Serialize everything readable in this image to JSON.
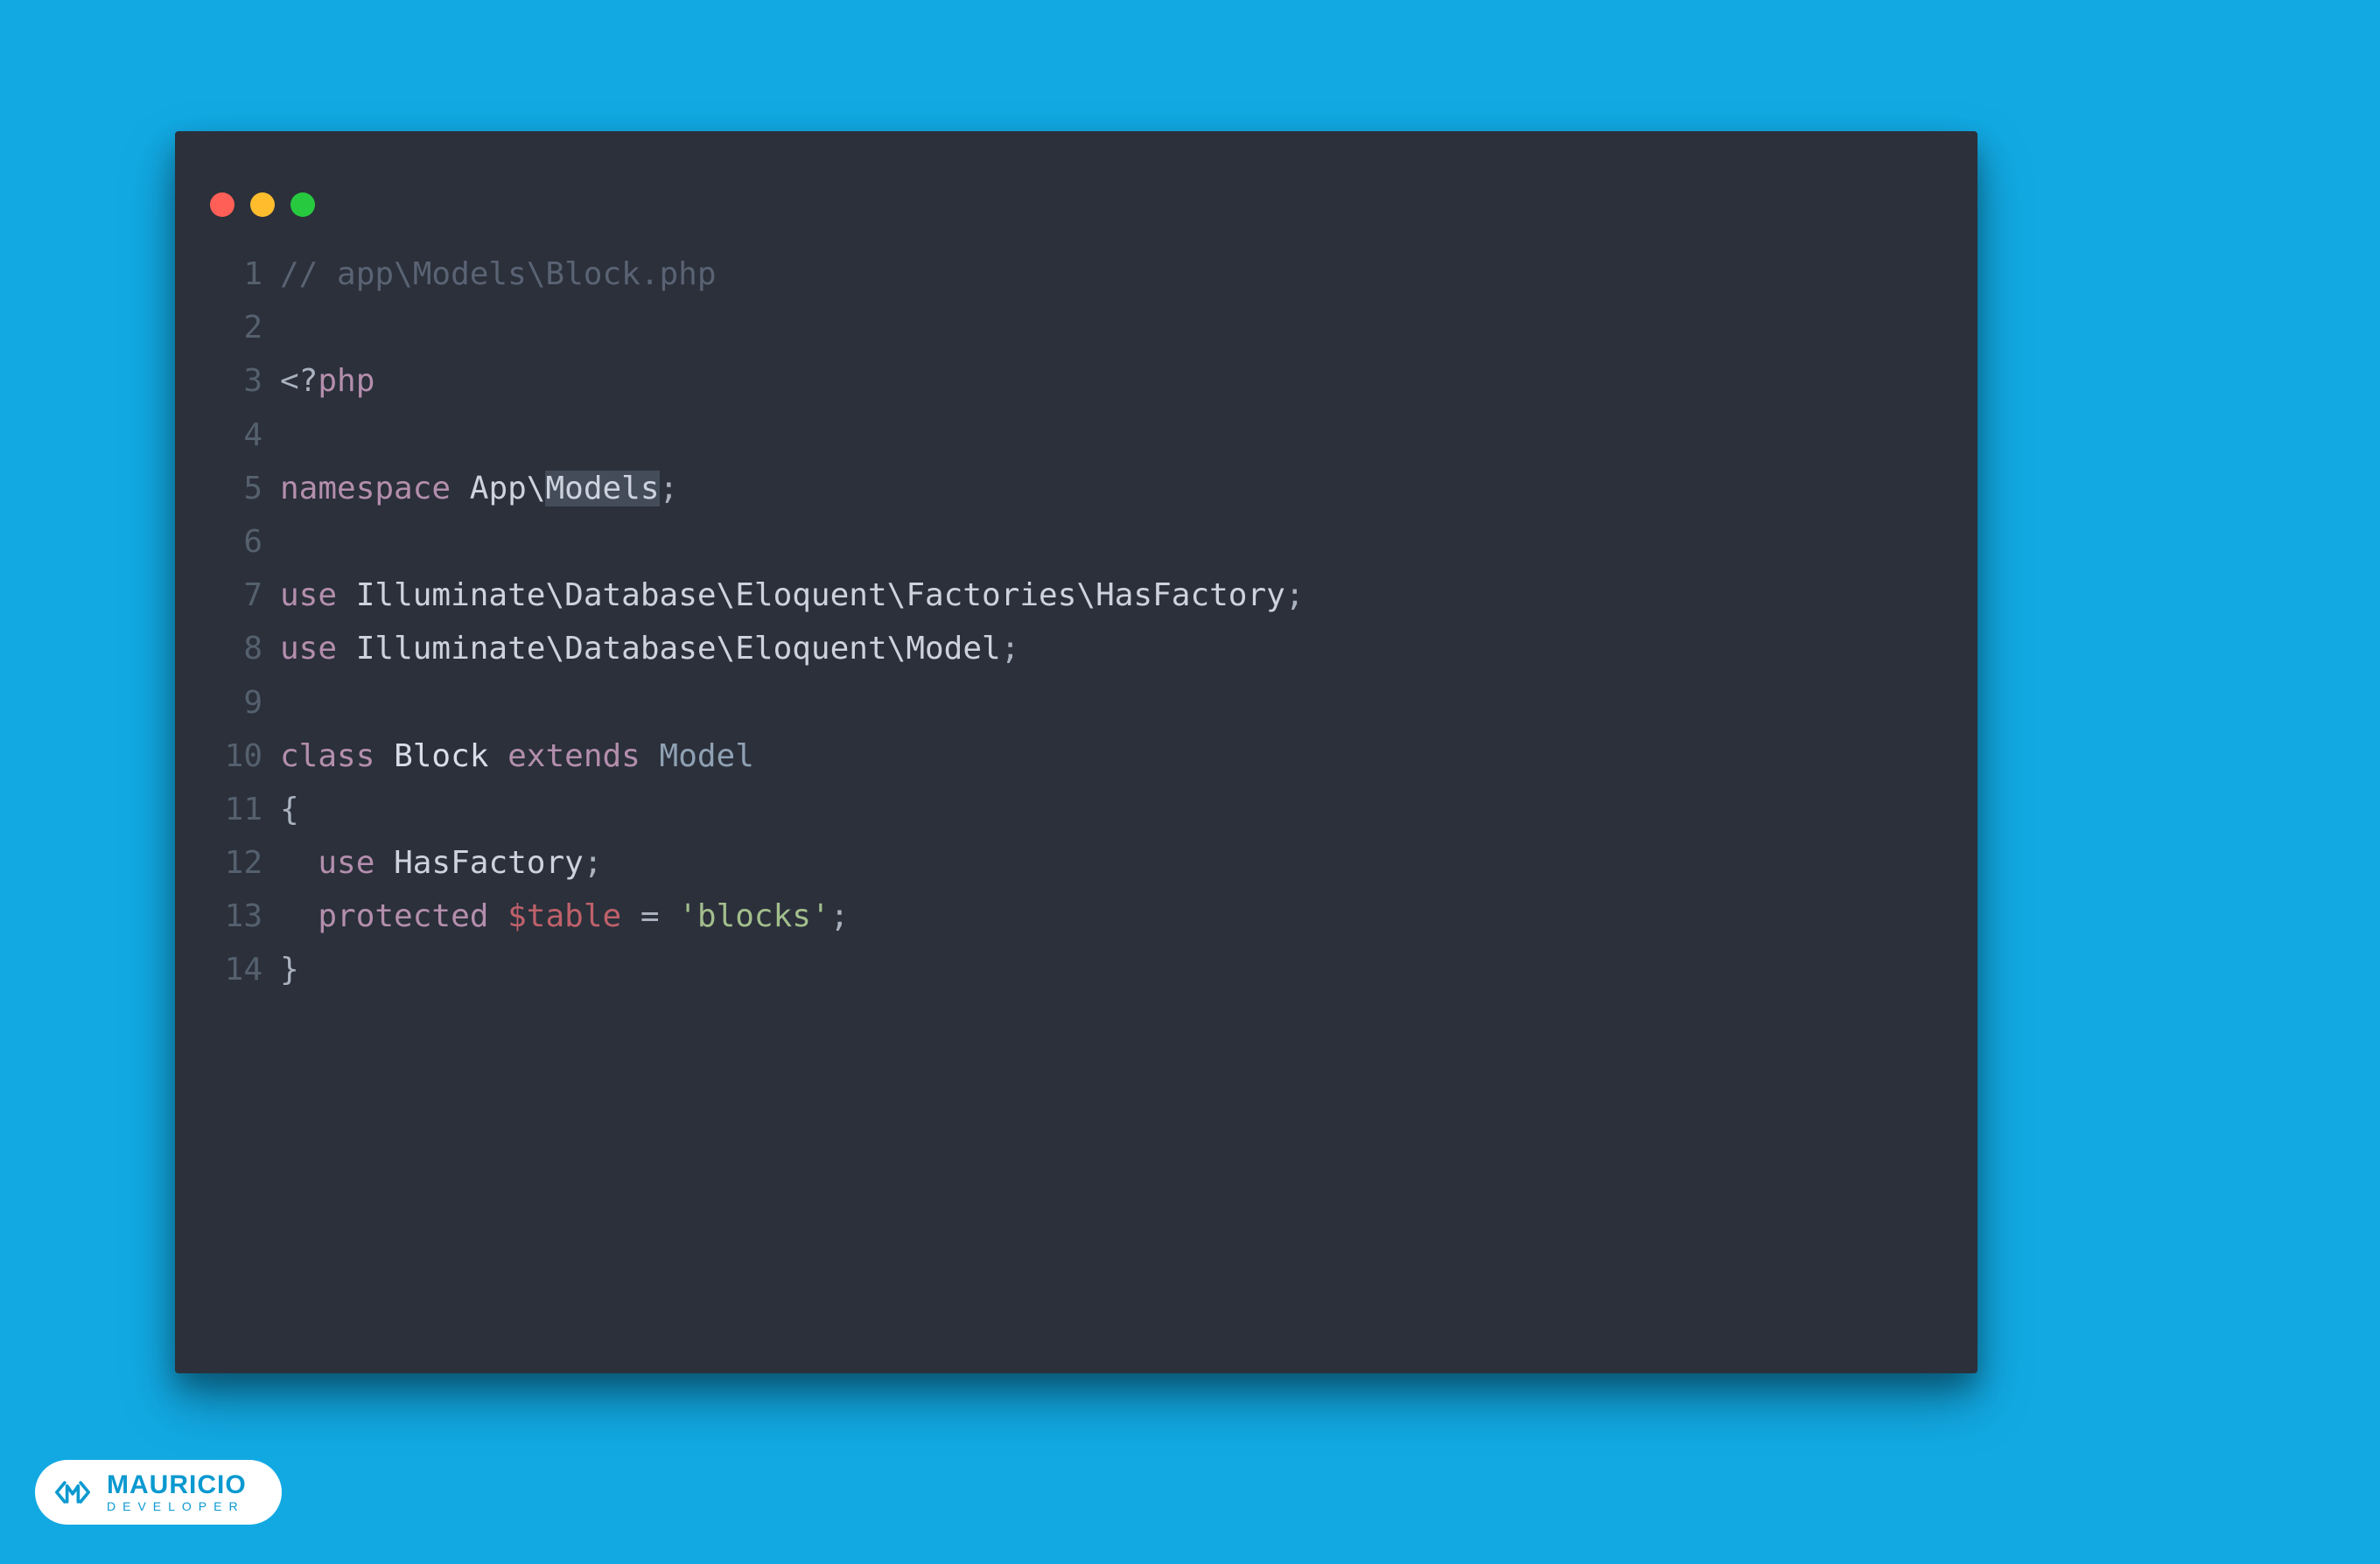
{
  "colors": {
    "background": "#12a9e3",
    "editor_bg": "#2b303b",
    "traffic_red": "#ff5f56",
    "traffic_yellow": "#ffbd2e",
    "traffic_green": "#27c93f"
  },
  "watermark": {
    "name": "MAURICIO",
    "subtitle": "DEVELOPER"
  },
  "code": {
    "language": "php",
    "file_path_comment": "// app\\Models\\Block.php",
    "lines": [
      {
        "n": "1",
        "tokens": [
          [
            "comment",
            "// app\\Models\\Block.php"
          ]
        ]
      },
      {
        "n": "2",
        "tokens": []
      },
      {
        "n": "3",
        "tokens": [
          [
            "punct",
            "<?"
          ],
          [
            "keyword",
            "php"
          ]
        ]
      },
      {
        "n": "4",
        "tokens": []
      },
      {
        "n": "5",
        "tokens": [
          [
            "keyword",
            "namespace"
          ],
          [
            "plain",
            " "
          ],
          [
            "plain",
            "App"
          ],
          [
            "plain",
            "\\"
          ],
          [
            "highlight",
            "Models"
          ],
          [
            "punct",
            ";"
          ]
        ]
      },
      {
        "n": "6",
        "tokens": []
      },
      {
        "n": "7",
        "tokens": [
          [
            "keyword",
            "use"
          ],
          [
            "plain",
            " "
          ],
          [
            "plain",
            "Illuminate"
          ],
          [
            "plain",
            "\\"
          ],
          [
            "plain",
            "Database"
          ],
          [
            "plain",
            "\\"
          ],
          [
            "plain",
            "Eloquent"
          ],
          [
            "plain",
            "\\"
          ],
          [
            "plain",
            "Factories"
          ],
          [
            "plain",
            "\\"
          ],
          [
            "plain",
            "HasFactory"
          ],
          [
            "punct",
            ";"
          ]
        ]
      },
      {
        "n": "8",
        "tokens": [
          [
            "keyword",
            "use"
          ],
          [
            "plain",
            " "
          ],
          [
            "plain",
            "Illuminate"
          ],
          [
            "plain",
            "\\"
          ],
          [
            "plain",
            "Database"
          ],
          [
            "plain",
            "\\"
          ],
          [
            "plain",
            "Eloquent"
          ],
          [
            "plain",
            "\\"
          ],
          [
            "plain",
            "Model"
          ],
          [
            "punct",
            ";"
          ]
        ]
      },
      {
        "n": "9",
        "tokens": []
      },
      {
        "n": "10",
        "tokens": [
          [
            "keyword",
            "class"
          ],
          [
            "plain",
            " "
          ],
          [
            "class",
            "Block"
          ],
          [
            "plain",
            " "
          ],
          [
            "keyword",
            "extends"
          ],
          [
            "plain",
            " "
          ],
          [
            "type",
            "Model"
          ]
        ]
      },
      {
        "n": "11",
        "tokens": [
          [
            "punct",
            "{"
          ]
        ]
      },
      {
        "n": "12",
        "tokens": [
          [
            "plain",
            "  "
          ],
          [
            "keyword",
            "use"
          ],
          [
            "plain",
            " "
          ],
          [
            "plain",
            "HasFactory"
          ],
          [
            "punct",
            ";"
          ]
        ]
      },
      {
        "n": "13",
        "tokens": [
          [
            "plain",
            "  "
          ],
          [
            "keyword",
            "protected"
          ],
          [
            "plain",
            " "
          ],
          [
            "var",
            "$table"
          ],
          [
            "plain",
            " "
          ],
          [
            "op",
            "="
          ],
          [
            "plain",
            " "
          ],
          [
            "string",
            "'blocks'"
          ],
          [
            "punct",
            ";"
          ]
        ]
      },
      {
        "n": "14",
        "tokens": [
          [
            "punct",
            "}"
          ]
        ]
      }
    ]
  }
}
